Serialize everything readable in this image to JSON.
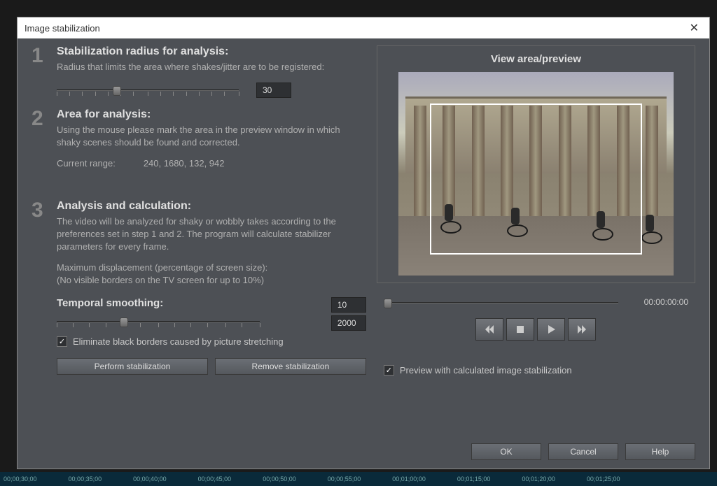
{
  "dialog": {
    "title": "Image stabilization"
  },
  "step1": {
    "title": "Stabilization radius for analysis:",
    "desc": "Radius that limits the area where shakes/jitter are to be registered:",
    "value": "30"
  },
  "step2": {
    "title": "Area for analysis:",
    "desc": "Using the mouse please mark the area in the preview window in which shaky scenes should be found and corrected.",
    "range_label": "Current range:",
    "range_value": "240, 1680, 132, 942"
  },
  "step3": {
    "title": "Analysis and calculation:",
    "desc": "The video will be analyzed for shaky or wobbly takes according to the preferences set in step 1 and 2. The program will calculate stabilizer parameters for every frame.",
    "max_disp_line1": "Maximum displacement (percentage of screen size):",
    "max_disp_line2": "(No visible borders on the TV screen for up to 10%)",
    "temporal_title": "Temporal smoothing:",
    "temporal_value": "10",
    "temporal_max": "2000",
    "eliminate_label": "Eliminate black borders caused by picture stretching",
    "perform_label": "Perform stabilization",
    "remove_label": "Remove stabilization"
  },
  "preview": {
    "title": "View area/preview",
    "timecode": "00:00:00:00",
    "checkbox_label": "Preview with calculated image stabilization"
  },
  "footer": {
    "ok": "OK",
    "cancel": "Cancel",
    "help": "Help"
  },
  "timeline": [
    "00;00;30;00",
    "00;00;35;00",
    "00;00;40;00",
    "00;00;45;00",
    "00;00;50;00",
    "00;00;55;00",
    "00;01;00;00",
    "00;01;15;00",
    "00;01;20;00",
    "00;01;25;00"
  ]
}
